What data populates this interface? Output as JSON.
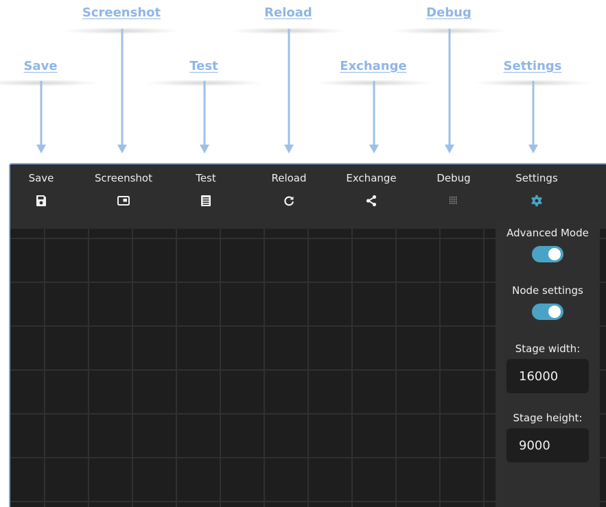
{
  "annotations": [
    {
      "id": "save",
      "text": "Save"
    },
    {
      "id": "screenshot",
      "text": "Screenshot"
    },
    {
      "id": "test",
      "text": "Test"
    },
    {
      "id": "reload",
      "text": "Reload"
    },
    {
      "id": "exchange",
      "text": "Exchange"
    },
    {
      "id": "debug",
      "text": "Debug"
    },
    {
      "id": "settings",
      "text": "Settings"
    }
  ],
  "toolbar": {
    "items": [
      {
        "label": "Save",
        "icon": "save-icon"
      },
      {
        "label": "Screenshot",
        "icon": "screenshot-icon"
      },
      {
        "label": "Test",
        "icon": "test-icon"
      },
      {
        "label": "Reload",
        "icon": "reload-icon"
      },
      {
        "label": "Exchange",
        "icon": "share-icon"
      },
      {
        "label": "Debug",
        "icon": "debug-grid-icon"
      },
      {
        "label": "Settings",
        "icon": "gear-icon"
      }
    ]
  },
  "settings_panel": {
    "advanced_mode": {
      "label": "Advanced Mode",
      "enabled": true
    },
    "node_settings": {
      "label": "Node settings",
      "enabled": true
    },
    "stage_width": {
      "label": "Stage width:",
      "value": "16000"
    },
    "stage_height": {
      "label": "Stage height:",
      "value": "9000"
    }
  },
  "colors": {
    "annotation": "#8fb6e6",
    "toolbar_bg": "#2e2e2e",
    "stage_bg": "#1e1e1e",
    "panel_bg": "#2f2f2f",
    "toggle_on": "#4aa3c4",
    "active_icon": "#4aa3c4"
  }
}
